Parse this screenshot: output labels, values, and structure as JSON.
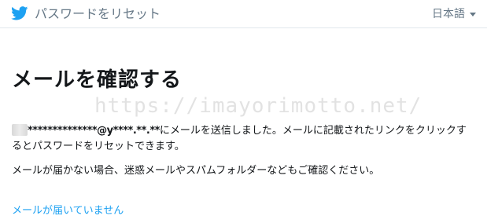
{
  "header": {
    "title": "パスワードをリセット",
    "language": "日本語",
    "brand_color": "#1da1f2"
  },
  "icons": {
    "logo": "twitter-bird-icon",
    "language_caret": "caret-down-icon",
    "masked_avatar": "blurred-redaction"
  },
  "main": {
    "title": "メールを確認する",
    "watermark": "https://imayorimotto.net/",
    "email_masked": "**************@y****.**.**",
    "message_sent": "にメールを送信しました。メールに記載されたリンクをクリックするとパスワードをリセットできます。",
    "message_spam": "メールが届かない場合、迷惑メールやスパムフォルダーなどもご確認ください。",
    "not_received_link": "メールが届いていません"
  }
}
